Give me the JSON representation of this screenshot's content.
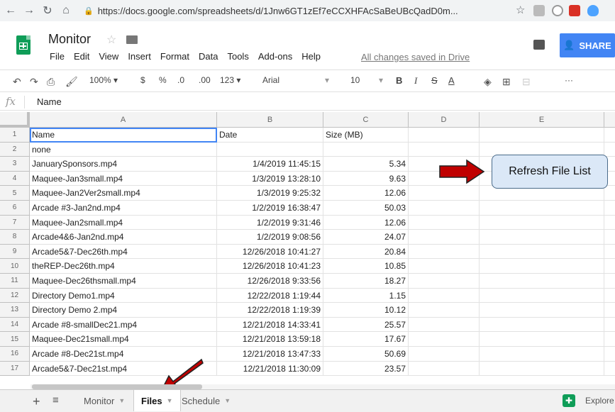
{
  "browser": {
    "url": "https://docs.google.com/spreadsheets/d/1Jnw6GT1zEf7eCCXHFAcSaBeUBcQadD0m..."
  },
  "doc": {
    "title": "Monitor",
    "menu": [
      "File",
      "Edit",
      "View",
      "Insert",
      "Format",
      "Data",
      "Tools",
      "Add-ons",
      "Help"
    ],
    "saved_status": "All changes saved in Drive",
    "share_label": "SHARE"
  },
  "toolbar": {
    "zoom": "100%",
    "currency": "$",
    "percent": "%",
    "dec_less": ".0",
    "dec_more": ".00",
    "format_more": "123",
    "font": "Arial",
    "font_size": "10",
    "bold": "B",
    "italic": "I",
    "strike": "S",
    "text_color": "A",
    "more": "···"
  },
  "formula_bar": {
    "fx": "fx",
    "value": "Name"
  },
  "columns": [
    "A",
    "B",
    "C",
    "D",
    "E"
  ],
  "rows": [
    {
      "num": "1",
      "a": "Name",
      "b": "Date",
      "c": "Size (MB)"
    },
    {
      "num": "2",
      "a": "none",
      "b": "",
      "c": ""
    },
    {
      "num": "3",
      "a": "JanuarySponsors.mp4",
      "b": "1/4/2019 11:45:15",
      "c": "5.34"
    },
    {
      "num": "4",
      "a": "Maquee-Jan3small.mp4",
      "b": "1/3/2019 13:28:10",
      "c": "9.63"
    },
    {
      "num": "5",
      "a": "Maquee-Jan2Ver2small.mp4",
      "b": "1/3/2019 9:25:32",
      "c": "12.06"
    },
    {
      "num": "6",
      "a": "Arcade #3-Jan2nd.mp4",
      "b": "1/2/2019 16:38:47",
      "c": "50.03"
    },
    {
      "num": "7",
      "a": "Maquee-Jan2small.mp4",
      "b": "1/2/2019 9:31:46",
      "c": "12.06"
    },
    {
      "num": "8",
      "a": "Arcade4&6-Jan2nd.mp4",
      "b": "1/2/2019 9:08:56",
      "c": "24.07"
    },
    {
      "num": "9",
      "a": "Arcade5&7-Dec26th.mp4",
      "b": "12/26/2018 10:41:27",
      "c": "20.84"
    },
    {
      "num": "10",
      "a": "theREP-Dec26th.mp4",
      "b": "12/26/2018 10:41:23",
      "c": "10.85"
    },
    {
      "num": "11",
      "a": "Maquee-Dec26thsmall.mp4",
      "b": "12/26/2018 9:33:56",
      "c": "18.27"
    },
    {
      "num": "12",
      "a": "Directory Demo1.mp4",
      "b": "12/22/2018 1:19:44",
      "c": "1.15"
    },
    {
      "num": "13",
      "a": "Directory Demo 2.mp4",
      "b": "12/22/2018 1:19:39",
      "c": "10.12"
    },
    {
      "num": "14",
      "a": "Arcade #8-smallDec21.mp4",
      "b": "12/21/2018 14:33:41",
      "c": "25.57"
    },
    {
      "num": "15",
      "a": "Maquee-Dec21small.mp4",
      "b": "12/21/2018 13:59:18",
      "c": "17.67"
    },
    {
      "num": "16",
      "a": "Arcade #8-Dec21st.mp4",
      "b": "12/21/2018 13:47:33",
      "c": "50.69"
    },
    {
      "num": "17",
      "a": "Arcade5&7-Dec21st.mp4",
      "b": "12/21/2018 11:30:09",
      "c": "23.57"
    }
  ],
  "callout": {
    "label": "Refresh File List"
  },
  "sheet_tabs": [
    "Monitor",
    "Files",
    "Schedule"
  ],
  "active_tab": "Files",
  "explore_label": "Explore",
  "colors": {
    "arrow_red": "#c00000",
    "share_blue": "#4285f4",
    "sheets_green": "#0f9d58"
  }
}
